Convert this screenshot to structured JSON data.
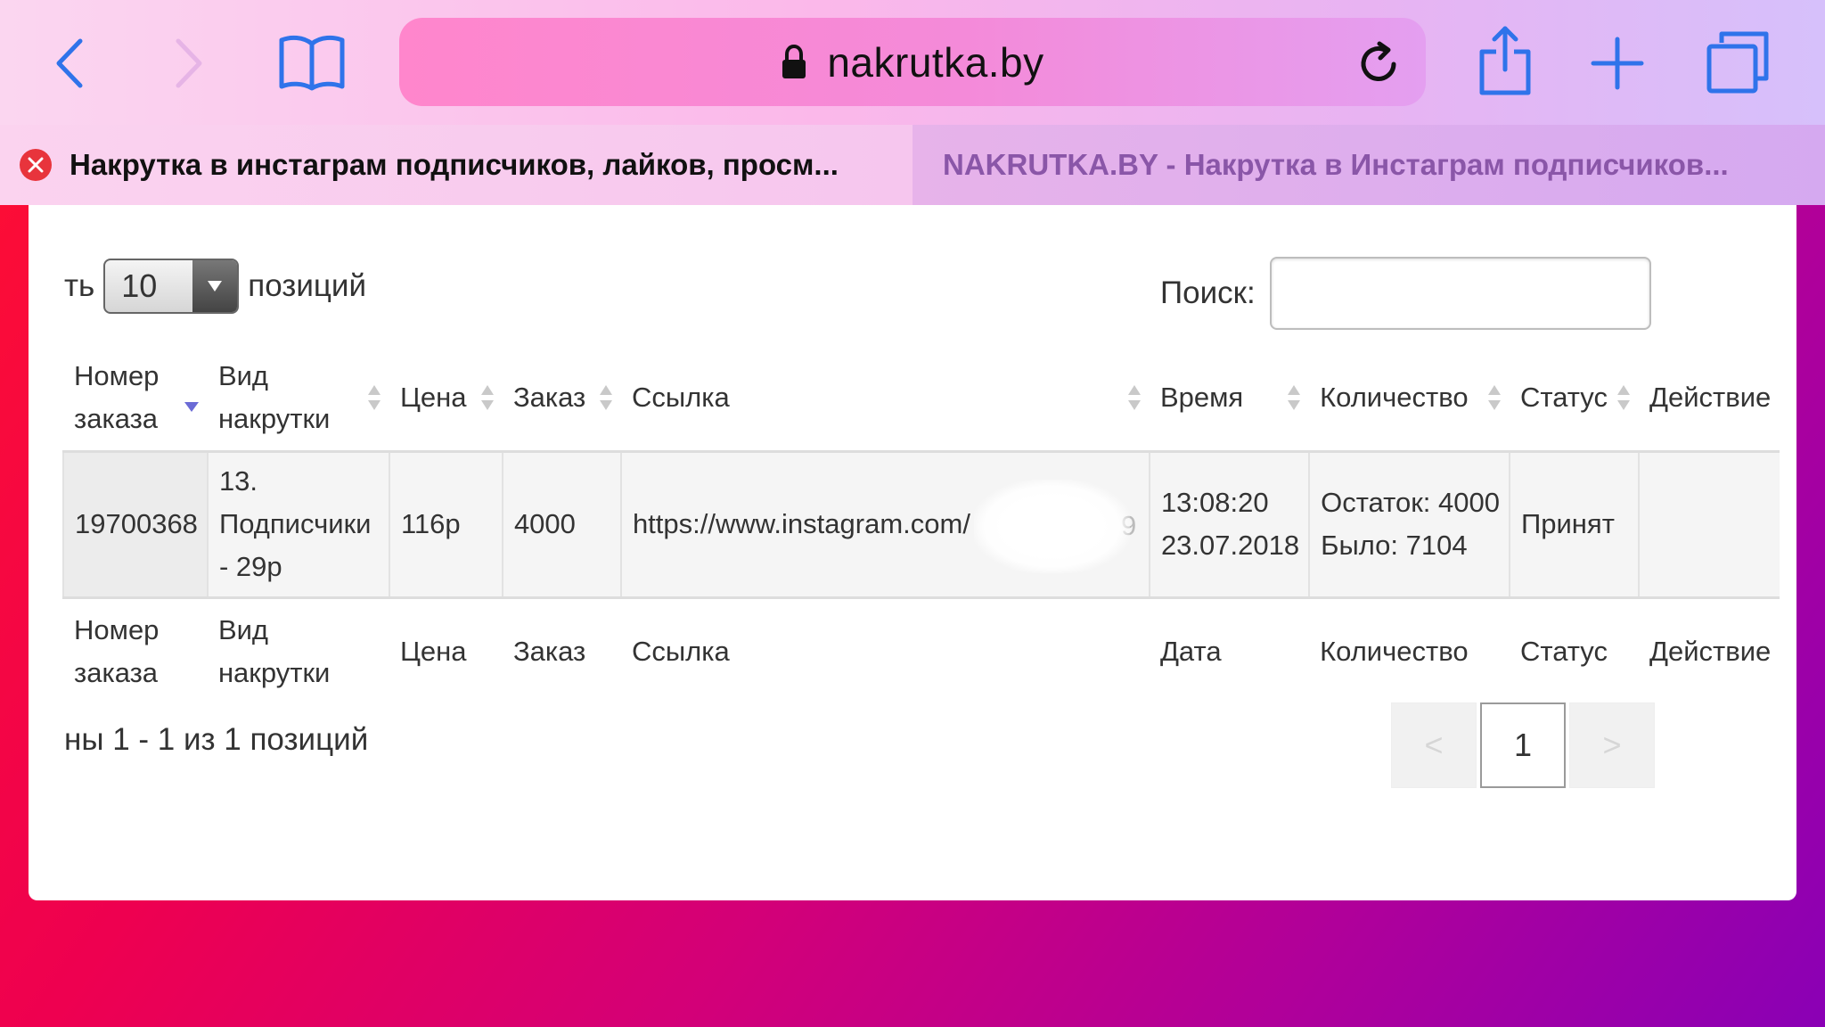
{
  "browser": {
    "url": "nakrutka.by",
    "tabs": [
      {
        "title": "Накрутка в инстаграм подписчиков, лайков, просм...",
        "active": true
      },
      {
        "title": "NAKRUTKA.BY - Накрутка в Инстаграм подписчиков...",
        "active": false
      }
    ],
    "icons": [
      "back-icon",
      "forward-icon",
      "bookmarks-icon",
      "lock-icon",
      "reload-icon",
      "share-icon",
      "new-tab-icon",
      "tabs-overview-icon",
      "tab-close-icon"
    ]
  },
  "table_controls": {
    "length_prefix": "ть",
    "length_value": "10",
    "length_suffix": "позиций",
    "search_label": "Поиск:",
    "search_value": ""
  },
  "table": {
    "headers": [
      "Номер заказа",
      "Вид накрутки",
      "Цена",
      "Заказ",
      "Ссылка",
      "Время",
      "Количество",
      "Статус",
      "Действие"
    ],
    "footers": [
      "Номер заказа",
      "Вид накрутки",
      "Цена",
      "Заказ",
      "Ссылка",
      "Дата",
      "Количество",
      "Статус",
      "Действие"
    ],
    "rows": [
      {
        "order_number": "19700368",
        "service": "13. Подписчики - 29р",
        "price": "116р",
        "order_qty": "4000",
        "link": "https://www.instagram.com/",
        "link_tail": "9",
        "time": "13:08:20",
        "date": "23.07.2018",
        "remaining": "Остаток: 4000",
        "was": "Было: 7104",
        "status": "Принят",
        "action": ""
      }
    ]
  },
  "info_text": "ны 1 - 1 из 1 позиций",
  "pagination": {
    "prev": "<",
    "current": "1",
    "next": ">"
  },
  "colors": {
    "sort_active": "#6b6bd6",
    "sort_inactive": "#c9c9c9",
    "tab_close": "#e8343c",
    "toolbar_icons": "#2f73ea"
  }
}
